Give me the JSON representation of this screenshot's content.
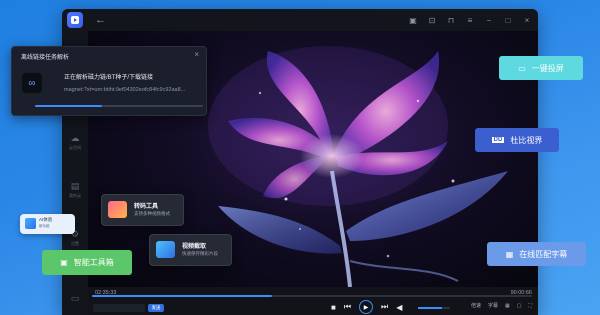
{
  "window": {
    "title_icons": [
      "feedback-icon",
      "box-icon",
      "lock-icon",
      "menu-icon",
      "minimize-icon",
      "maximize-icon",
      "close-icon"
    ]
  },
  "sidebar": {
    "items": [
      {
        "label": "云空间",
        "icon": "cloud-icon"
      },
      {
        "label": "我的云",
        "icon": "cloud-folder-icon"
      },
      {
        "label": "设置",
        "icon": "settings-icon"
      }
    ]
  },
  "task_panel": {
    "title": "离线链接任务解析",
    "status": "正在解析磁力链/BT种子/下载链接",
    "link": "magnet:?xt=urn:btiht:9ef04302eofc84fc9c92aa8...",
    "progress": 0.4
  },
  "tools": {
    "converter": {
      "title": "转码工具",
      "subtitle": "支持多种视频格式"
    },
    "screenshot": {
      "title": "视频截取",
      "subtitle": "快速保存精彩片段"
    }
  },
  "promos": {
    "cast": {
      "label": "一键投屏"
    },
    "dolby": {
      "label": "杜比视界"
    },
    "subtitle": {
      "label": "在线匹配字幕"
    },
    "toolbox": {
      "label": "智能工具箱"
    },
    "mini": {
      "label": "AI体验",
      "sub": "新功能"
    }
  },
  "player": {
    "current_time": "02:35:33",
    "total_time": "90:00:66",
    "send_label": "发送",
    "progress": 0.41,
    "volume": 0.75,
    "right_controls": [
      "倍速",
      "字幕"
    ]
  },
  "colors": {
    "accent": "#3a8cff",
    "panel_cyan": "#5ed9e0",
    "panel_indigo": "#3b5fcf",
    "panel_green": "#5cc76a",
    "subtitle_blue": "#6a9ae8"
  }
}
